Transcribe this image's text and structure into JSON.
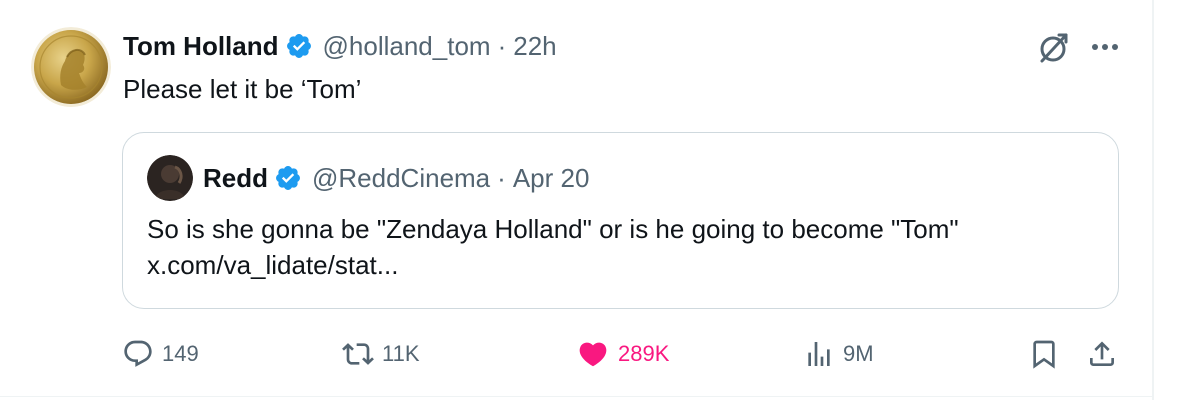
{
  "tweet": {
    "author": {
      "name": "Tom Holland",
      "handle": "@holland_tom",
      "verified": true
    },
    "separator": "·",
    "time": "22h",
    "text": "Please let it be ‘Tom’"
  },
  "quote": {
    "author": {
      "name": "Redd",
      "handle": "@ReddCinema",
      "verified": true
    },
    "separator": "·",
    "date": "Apr 20",
    "text_line_1": "So is she gonna be \"Zendaya Holland\" or is he going to become \"Tom\"",
    "text_line_2": "x.com/va_lidate/stat..."
  },
  "actions": {
    "replies": "149",
    "reposts": "11K",
    "likes": "289K",
    "views": "9M",
    "liked": true
  },
  "colors": {
    "text_primary": "#0f1419",
    "text_secondary": "#536471",
    "verified_blue": "#1d9bf0",
    "like_pink": "#f91880",
    "border": "#cfd9de"
  },
  "icons": {
    "verified": "verified-badge-icon",
    "grok": "grok-icon",
    "more": "more-icon",
    "reply": "reply-icon",
    "repost": "repost-icon",
    "like": "heart-icon",
    "views": "views-icon",
    "bookmark": "bookmark-icon",
    "share": "share-icon"
  }
}
